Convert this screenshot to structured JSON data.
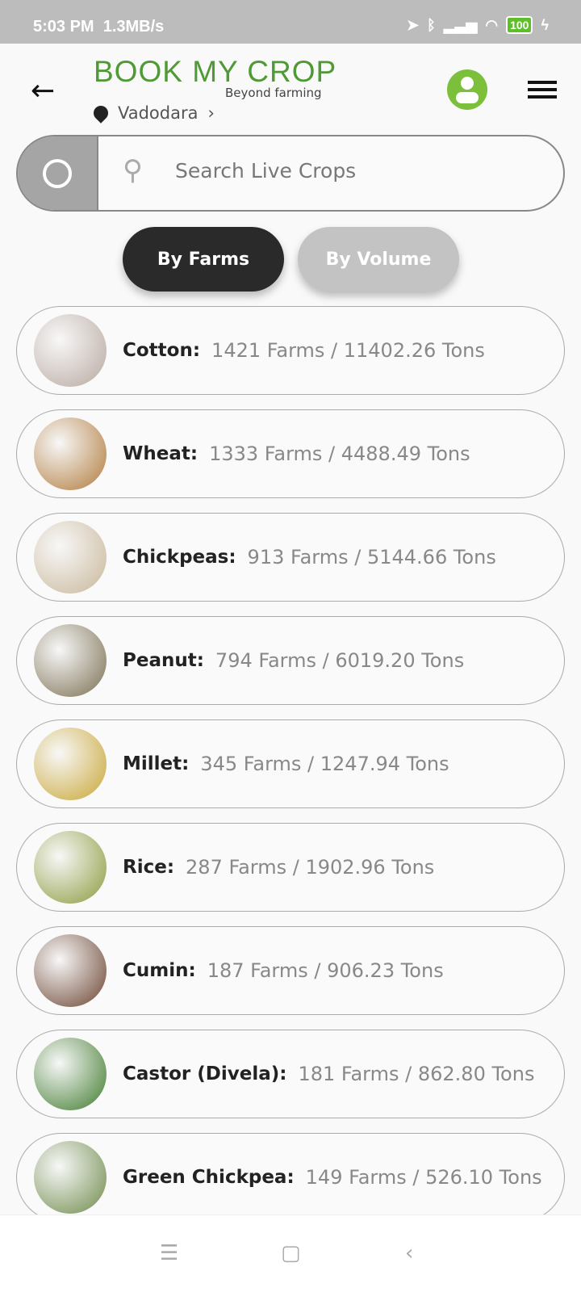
{
  "status_bar": {
    "time": "5:03 PM",
    "speed": "1.3MB/s",
    "battery": "100"
  },
  "header": {
    "logo": "BOOK MY CROP",
    "tagline": "Beyond farming",
    "location": "Vadodara"
  },
  "search": {
    "placeholder": "Search Live Crops"
  },
  "tabs": [
    {
      "label": "By Farms",
      "active": true
    },
    {
      "label": "By Volume",
      "active": false
    }
  ],
  "crops": [
    {
      "name": "Cotton:",
      "stats": "1421 Farms / 11402.26 Tons",
      "color": "#b8a8a0"
    },
    {
      "name": "Wheat:",
      "stats": "1333 Farms / 4488.49 Tons",
      "color": "#b07a3a"
    },
    {
      "name": "Chickpeas:",
      "stats": "913 Farms / 5144.66 Tons",
      "color": "#c9b79a"
    },
    {
      "name": "Peanut:",
      "stats": "794 Farms / 6019.20 Tons",
      "color": "#7a6e50"
    },
    {
      "name": "Millet:",
      "stats": "345 Farms / 1247.94 Tons",
      "color": "#c9a634"
    },
    {
      "name": "Rice:",
      "stats": "287 Farms / 1902.96 Tons",
      "color": "#8c9a3c"
    },
    {
      "name": "Cumin:",
      "stats": "187 Farms / 906.23 Tons",
      "color": "#6a4330"
    },
    {
      "name": "Castor (Divela):",
      "stats": "181 Farms / 862.80 Tons",
      "color": "#3e7a2c"
    },
    {
      "name": "Green Chickpea:",
      "stats": "149 Farms / 526.10 Tons",
      "color": "#6e8a4a"
    }
  ]
}
